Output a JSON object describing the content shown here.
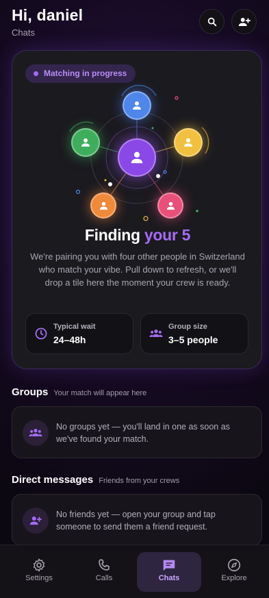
{
  "header": {
    "greeting": "Hi, daniel",
    "subtitle": "Chats",
    "search_icon": "search-icon",
    "add_user_icon": "person-add-icon"
  },
  "match_card": {
    "status_pill": "Matching in progress",
    "title_prefix": "Finding ",
    "title_accent": "your 5",
    "description": "We're pairing you with four other people in Switzerland who match your vibe. Pull down to refresh, or we'll drop a tile here the moment your crew is ready.",
    "stats": [
      {
        "icon": "clock-icon",
        "label": "Typical wait",
        "value": "24–48h"
      },
      {
        "icon": "group-icon",
        "label": "Group size",
        "value": "3–5 people"
      }
    ],
    "colors": {
      "center": "#8a48e6",
      "top": "#4f86ea",
      "left": "#3fae5c",
      "right": "#f2c041",
      "bottom_left": "#f08a3b",
      "bottom_right": "#e8507a",
      "accent": "#a66cf4"
    }
  },
  "groups": {
    "title": "Groups",
    "subtitle": "Your match will appear here",
    "empty_text": "No groups yet — you'll land in one as soon as we've found your match.",
    "icon": "group-icon"
  },
  "direct_messages": {
    "title": "Direct messages",
    "subtitle": "Friends from your crews",
    "empty_text": "No friends yet — open your group and tap someone to send them a friend request.",
    "icon": "person-add-icon"
  },
  "bottom_nav": {
    "items": [
      {
        "label": "Settings",
        "icon": "gear-icon",
        "active": false
      },
      {
        "label": "Calls",
        "icon": "phone-icon",
        "active": false
      },
      {
        "label": "Chats",
        "icon": "chat-icon",
        "active": true
      },
      {
        "label": "Explore",
        "icon": "compass-icon",
        "active": false
      }
    ]
  }
}
